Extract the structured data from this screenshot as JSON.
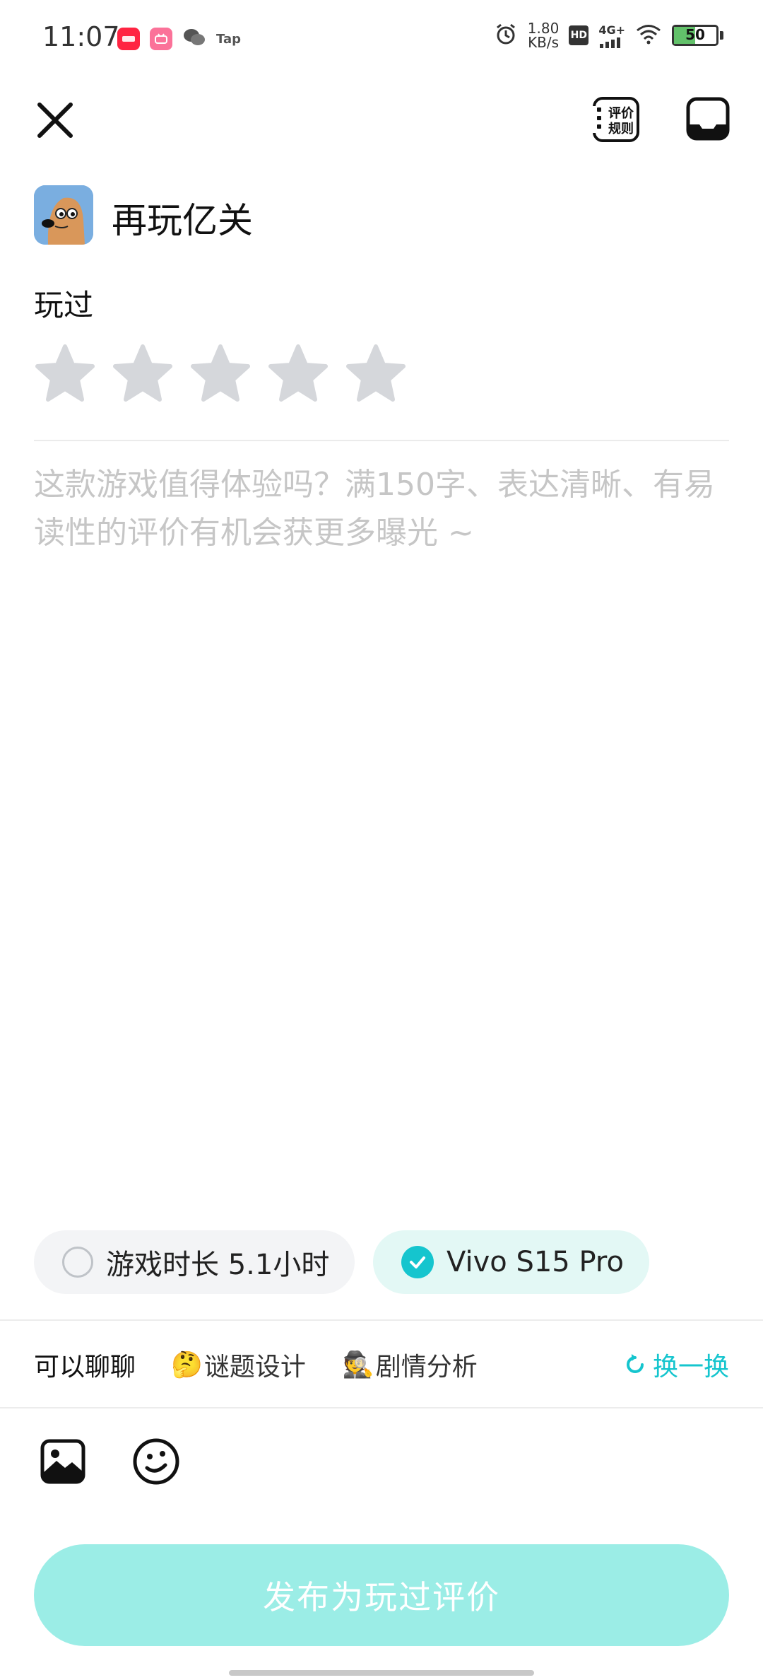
{
  "status_bar": {
    "time": "11:07",
    "app_icons": [
      "小红书",
      "bilibili",
      "wechat",
      "Tap"
    ],
    "tap_label": "Tap",
    "net_speed_value": "1.80",
    "net_speed_unit": "KB/s",
    "hd_label": "HD",
    "signal_label": "4G+",
    "battery_level": "50",
    "battery_color": "#62c16a"
  },
  "nav": {
    "close_icon": "close-icon",
    "rules_label": "评价规则",
    "chat_icon": "chat-icon"
  },
  "game": {
    "name": "再玩亿关",
    "icon": "game-mascot-icon"
  },
  "rating": {
    "label": "玩过",
    "max_stars": 5,
    "selected": 0,
    "inactive_color": "#d5d7db"
  },
  "review": {
    "placeholder": "这款游戏值得体验吗？满150字、表达清晰、有易读性的评价有机会获更多曝光 ~",
    "value": ""
  },
  "chips": {
    "playtime": "游戏时长 5.1小时",
    "playtime_checked": false,
    "device": "Vivo S15 Pro",
    "device_checked": true
  },
  "topics": {
    "prompt": "可以聊聊",
    "tags": [
      {
        "emoji": "🤔",
        "label": "谜题设计"
      },
      {
        "emoji": "🕵",
        "label": "剧情分析"
      }
    ],
    "refresh_label": "换一换"
  },
  "toolbar": {
    "image_icon": "image-icon",
    "emoji_icon": "emoji-icon"
  },
  "publish": {
    "label": "发布为玩过评价"
  },
  "colors": {
    "accent": "#15c5ce",
    "publish_bg": "#9bede6",
    "device_chip_bg": "#e3f8f5"
  }
}
